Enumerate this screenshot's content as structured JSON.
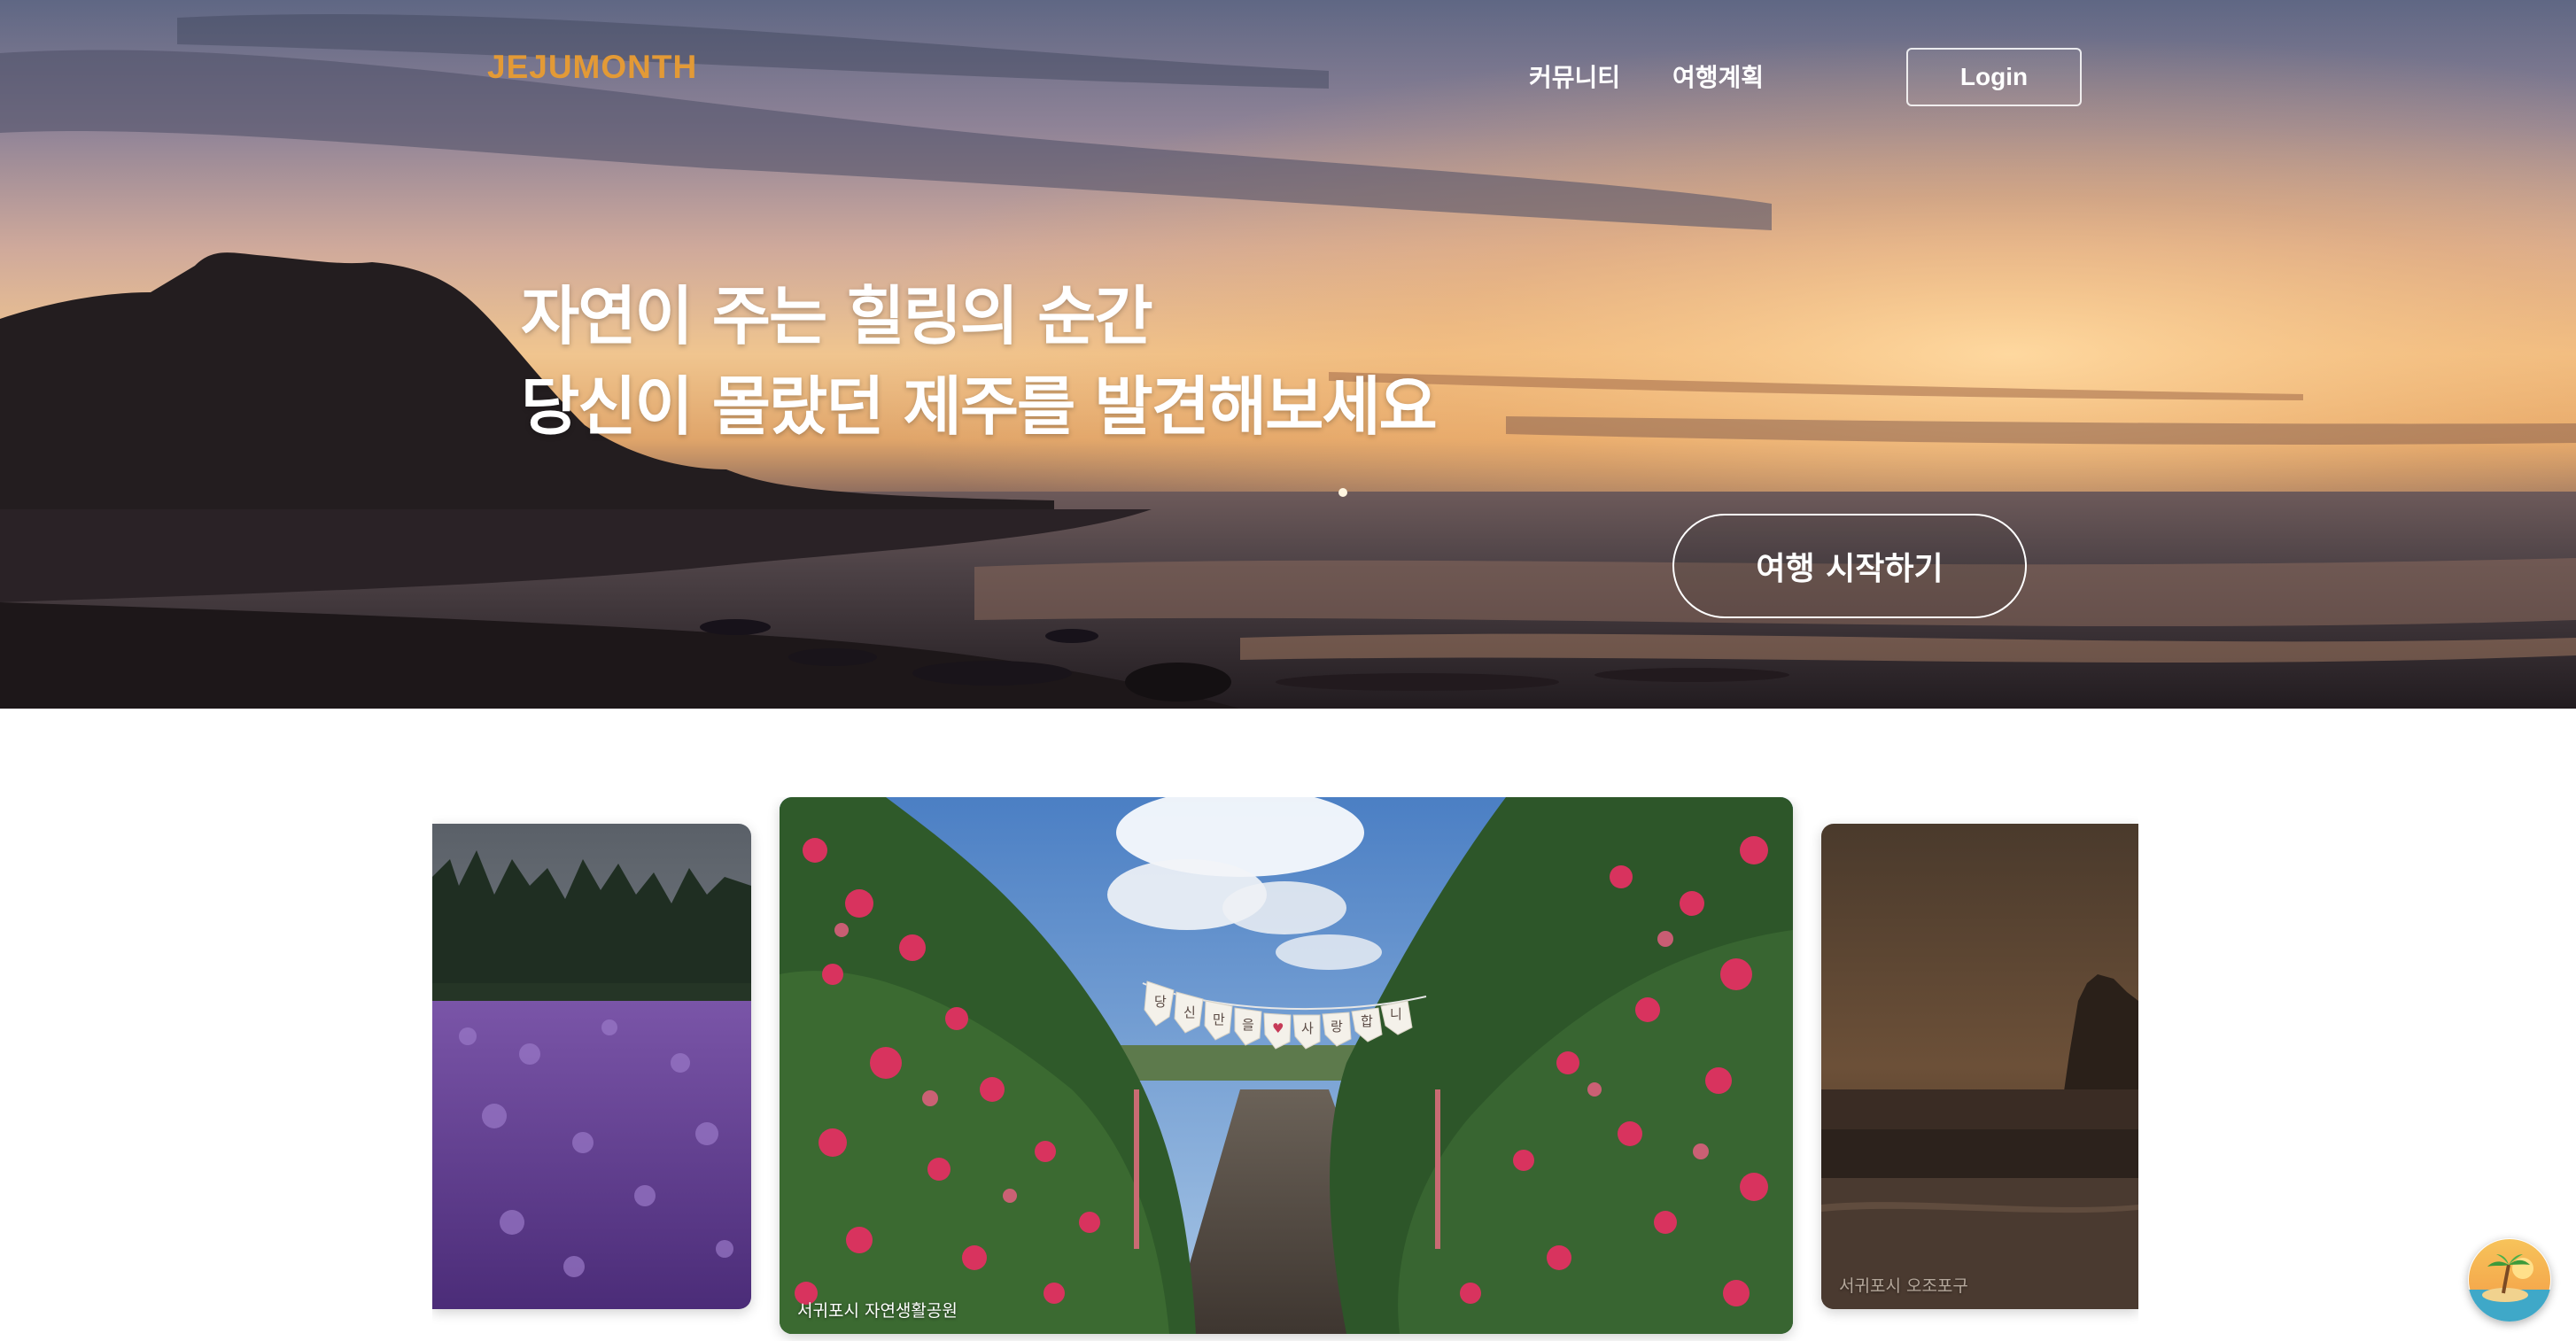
{
  "brand": {
    "logo": "JEJUMONTH",
    "accent": "#e39a36"
  },
  "nav": {
    "community": "커뮤니티",
    "plan": "여행계획",
    "login": "Login"
  },
  "hero": {
    "line1": "자연이 주는 힐링의 순간",
    "line2": "당신이 몰랐던 제주를 발견해보세요",
    "cta": "여행 시작하기"
  },
  "carousel": {
    "cards": [
      {
        "caption": ""
      },
      {
        "caption": "서귀포시 자연생활공원",
        "banner": "당신만을사랑합니다"
      },
      {
        "caption": "서귀포시 오조포구"
      }
    ]
  },
  "fab": {
    "icon": "palm-island-icon"
  }
}
